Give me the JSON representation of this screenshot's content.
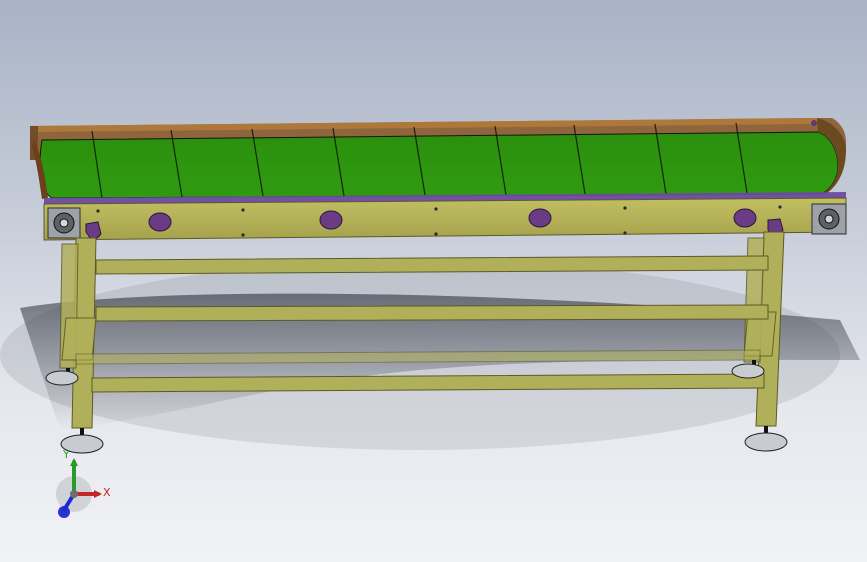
{
  "app": {
    "title": ""
  },
  "model": {
    "object": "belt-conveyor",
    "colors": {
      "belt": "#2f9b10",
      "belt_dark": "#1f6a08",
      "frame": "#b1b05a",
      "frame_dark": "#6f6d2f",
      "side_rail": "#8a5b2b",
      "edge_strip": "#6d4aa0",
      "purple_marks": "#6b3c86",
      "feet": "#c8cbd1",
      "shadow": "#5b606a"
    }
  },
  "triad": {
    "x_label": "X",
    "y_label": "Y",
    "x_color": "#c0282a",
    "y_color": "#2a9a2a",
    "z_color": "#1a2ad0"
  }
}
